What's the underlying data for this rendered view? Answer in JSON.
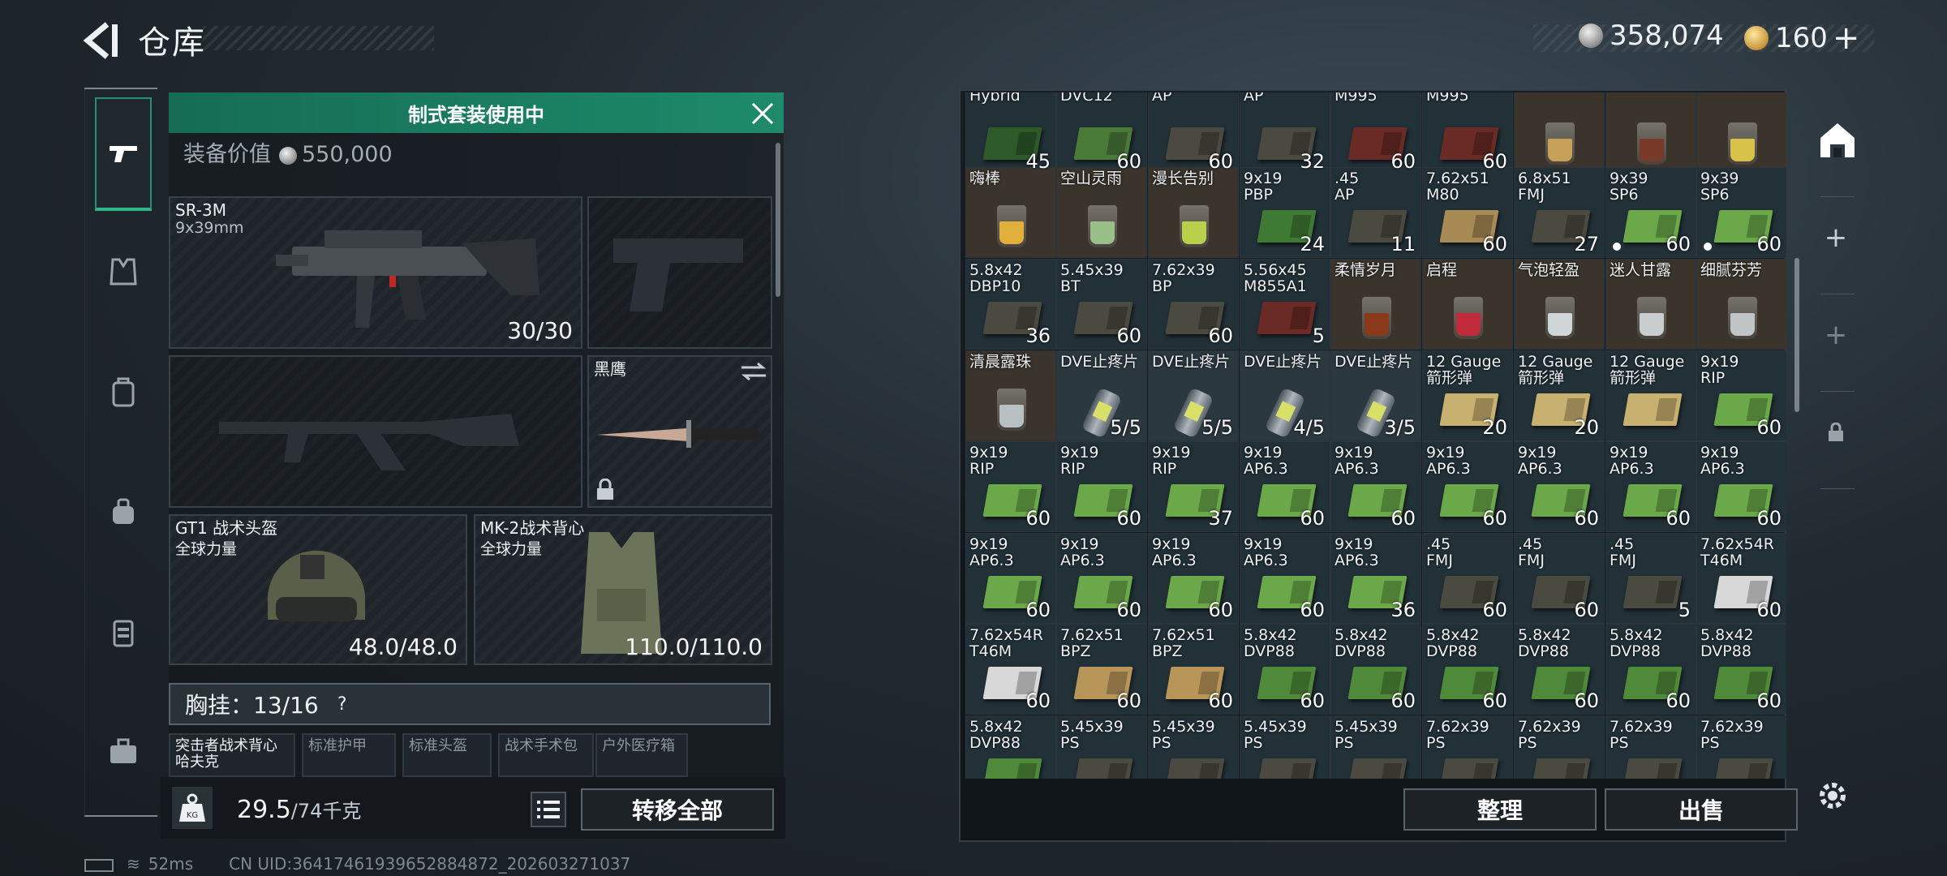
{
  "header": {
    "title": "仓库",
    "silver": "358,074",
    "gold": "160",
    "plus": "+"
  },
  "banner": {
    "text": "制式套装使用中"
  },
  "loadout": {
    "value_label": "装备价值",
    "value": "550,000",
    "primary": {
      "name": "SR-3M",
      "sub": "9x39mm",
      "ammo": "30/30"
    },
    "melee": {
      "name": "黑鹰"
    },
    "helmet": {
      "name": "GT1 战术头盔",
      "brand": "全球力量",
      "dur": "48.0/48.0"
    },
    "vest": {
      "name": "MK-2战术背心",
      "brand": "全球力量",
      "dur": "110.0/110.0"
    },
    "rig": {
      "label": "胸挂：13/16",
      "help": "?"
    },
    "rig_slots": [
      {
        "l1": "突击者战术背心",
        "l2": "哈夫克"
      },
      {
        "l1": "标准护甲",
        "l2": ""
      },
      {
        "l1": "标准头盔",
        "l2": ""
      },
      {
        "l1": "战术手术包",
        "l2": ""
      },
      {
        "l1": "户外医疗箱",
        "l2": ""
      }
    ],
    "weight": "29.5",
    "weight_max": "/74千克",
    "kg": "KG",
    "transfer": "转移全部"
  },
  "status": {
    "ping": "52ms",
    "uid": "CN UID:3641746193965288487​2_202603271037"
  },
  "grid_buttons": {
    "sort": "整理",
    "sell": "出售"
  },
  "grid": [
    [
      {
        "a": "Hybrid",
        "b": "",
        "c": "45",
        "k": "ammo",
        "col": "#2e5a2a"
      },
      {
        "a": "DVC12",
        "b": "",
        "c": "60",
        "k": "ammo",
        "col": "#4a7a38"
      },
      {
        "a": "AP",
        "b": "",
        "c": "60",
        "k": "ammo",
        "col": "#4a4a40"
      },
      {
        "a": "AP",
        "b": "",
        "c": "32",
        "k": "ammo",
        "col": "#4a4a40"
      },
      {
        "a": "M995",
        "b": "",
        "c": "60",
        "k": "ammo",
        "col": "#6a2a26"
      },
      {
        "a": "M995",
        "b": "",
        "c": "60",
        "k": "ammo",
        "col": "#6a2a26"
      },
      {
        "a": "",
        "b": "",
        "c": "",
        "k": "drink",
        "col": "#c7a05a"
      },
      {
        "a": "",
        "b": "",
        "c": "",
        "k": "drink",
        "col": "#7a3a2a"
      },
      {
        "a": "",
        "b": "",
        "c": "",
        "k": "drink",
        "col": "#d9c24a"
      }
    ],
    [
      {
        "a": "嗨棒",
        "b": "",
        "c": "",
        "k": "drink",
        "col": "#e0b03a"
      },
      {
        "a": "空山灵雨",
        "b": "",
        "c": "",
        "k": "drink",
        "col": "#9ac08a"
      },
      {
        "a": "漫长告别",
        "b": "",
        "c": "",
        "k": "drink",
        "col": "#b8d04a"
      },
      {
        "a": "9x19",
        "b": "PBP",
        "c": "24",
        "k": "ammo",
        "col": "#3f7a34"
      },
      {
        "a": ".45",
        "b": "AP",
        "c": "11",
        "k": "ammo",
        "col": "#4a4a40"
      },
      {
        "a": "7.62x51",
        "b": "M80",
        "c": "60",
        "k": "ammo",
        "col": "#a88a55"
      },
      {
        "a": "6.8x51",
        "b": "FMJ",
        "c": "27",
        "k": "ammo",
        "col": "#4a4a40"
      },
      {
        "a": "9x39",
        "b": "SP6",
        "c": "60",
        "k": "ammo",
        "col": "#6aa84a",
        "dot": true
      },
      {
        "a": "9x39",
        "b": "SP6",
        "c": "60",
        "k": "ammo",
        "col": "#6aa84a",
        "dot": true
      }
    ],
    [
      {
        "a": "5.8x42",
        "b": "DBP10",
        "c": "36",
        "k": "ammo",
        "col": "#4a4a40"
      },
      {
        "a": "5.45x39",
        "b": "BT",
        "c": "60",
        "k": "ammo",
        "col": "#4a4a40"
      },
      {
        "a": "7.62x39",
        "b": "BP",
        "c": "60",
        "k": "ammo",
        "col": "#4a4a40"
      },
      {
        "a": "5.56x45",
        "b": "M855A1",
        "c": "5",
        "k": "ammo",
        "col": "#6a2a26"
      },
      {
        "a": "柔情岁月",
        "b": "",
        "c": "",
        "k": "drink",
        "col": "#8a3a1a"
      },
      {
        "a": "启程",
        "b": "",
        "c": "",
        "k": "drink",
        "col": "#c02a3a"
      },
      {
        "a": "气泡轻盈",
        "b": "",
        "c": "",
        "k": "drink",
        "col": "#d0d6d8"
      },
      {
        "a": "迷人甘露",
        "b": "",
        "c": "",
        "k": "drink",
        "col": "#c8ced0"
      },
      {
        "a": "细腻芬芳",
        "b": "",
        "c": "",
        "k": "drink",
        "col": "#c0c6c8"
      }
    ],
    [
      {
        "a": "清晨露珠",
        "b": "",
        "c": "",
        "k": "drink",
        "col": "#b8c0c2"
      },
      {
        "a": "DVE止疼片",
        "b": "",
        "c": "5/5",
        "k": "inj"
      },
      {
        "a": "DVE止疼片",
        "b": "",
        "c": "5/5",
        "k": "inj"
      },
      {
        "a": "DVE止疼片",
        "b": "",
        "c": "4/5",
        "k": "inj"
      },
      {
        "a": "DVE止疼片",
        "b": "",
        "c": "3/5",
        "k": "inj"
      },
      {
        "a": "12 Gauge",
        "b": "箭形弹",
        "c": "20",
        "k": "ammo",
        "col": "#c8b070"
      },
      {
        "a": "12 Gauge",
        "b": "箭形弹",
        "c": "20",
        "k": "ammo",
        "col": "#c8b070"
      },
      {
        "a": "12 Gauge",
        "b": "箭形弹",
        "c": "",
        "k": "ammo",
        "col": "#c8b070"
      },
      {
        "a": "9x19",
        "b": "RIP",
        "c": "60",
        "k": "ammo",
        "col": "#6aa84a"
      }
    ],
    [
      {
        "a": "9x19",
        "b": "RIP",
        "c": "60",
        "k": "ammo",
        "col": "#6aa84a"
      },
      {
        "a": "9x19",
        "b": "RIP",
        "c": "60",
        "k": "ammo",
        "col": "#6aa84a"
      },
      {
        "a": "9x19",
        "b": "RIP",
        "c": "37",
        "k": "ammo",
        "col": "#6aa84a"
      },
      {
        "a": "9x19",
        "b": "AP6.3",
        "c": "60",
        "k": "ammo",
        "col": "#6aa84a"
      },
      {
        "a": "9x19",
        "b": "AP6.3",
        "c": "60",
        "k": "ammo",
        "col": "#6aa84a"
      },
      {
        "a": "9x19",
        "b": "AP6.3",
        "c": "60",
        "k": "ammo",
        "col": "#6aa84a"
      },
      {
        "a": "9x19",
        "b": "AP6.3",
        "c": "60",
        "k": "ammo",
        "col": "#6aa84a"
      },
      {
        "a": "9x19",
        "b": "AP6.3",
        "c": "60",
        "k": "ammo",
        "col": "#6aa84a"
      },
      {
        "a": "9x19",
        "b": "AP6.3",
        "c": "60",
        "k": "ammo",
        "col": "#6aa84a"
      }
    ],
    [
      {
        "a": "9x19",
        "b": "AP6.3",
        "c": "60",
        "k": "ammo",
        "col": "#6aa84a"
      },
      {
        "a": "9x19",
        "b": "AP6.3",
        "c": "60",
        "k": "ammo",
        "col": "#6aa84a"
      },
      {
        "a": "9x19",
        "b": "AP6.3",
        "c": "60",
        "k": "ammo",
        "col": "#6aa84a"
      },
      {
        "a": "9x19",
        "b": "AP6.3",
        "c": "60",
        "k": "ammo",
        "col": "#6aa84a"
      },
      {
        "a": "9x19",
        "b": "AP6.3",
        "c": "36",
        "k": "ammo",
        "col": "#6aa84a"
      },
      {
        "a": ".45",
        "b": "FMJ",
        "c": "60",
        "k": "ammo",
        "col": "#4a4a40"
      },
      {
        "a": ".45",
        "b": "FMJ",
        "c": "60",
        "k": "ammo",
        "col": "#4a4a40"
      },
      {
        "a": ".45",
        "b": "FMJ",
        "c": "5",
        "k": "ammo",
        "col": "#4a4a40"
      },
      {
        "a": "7.62x54R",
        "b": "T46M",
        "c": "60",
        "k": "ammo",
        "col": "#d8d8d8"
      }
    ],
    [
      {
        "a": "7.62x54R",
        "b": "T46M",
        "c": "60",
        "k": "ammo",
        "col": "#d8d8d8"
      },
      {
        "a": "7.62x51",
        "b": "BPZ",
        "c": "60",
        "k": "ammo",
        "col": "#b8965a"
      },
      {
        "a": "7.62x51",
        "b": "BPZ",
        "c": "60",
        "k": "ammo",
        "col": "#b8965a"
      },
      {
        "a": "5.8x42",
        "b": "DVP88",
        "c": "60",
        "k": "ammo",
        "col": "#4f8a3a"
      },
      {
        "a": "5.8x42",
        "b": "DVP88",
        "c": "60",
        "k": "ammo",
        "col": "#4f8a3a"
      },
      {
        "a": "5.8x42",
        "b": "DVP88",
        "c": "60",
        "k": "ammo",
        "col": "#4f8a3a"
      },
      {
        "a": "5.8x42",
        "b": "DVP88",
        "c": "60",
        "k": "ammo",
        "col": "#4f8a3a"
      },
      {
        "a": "5.8x42",
        "b": "DVP88",
        "c": "60",
        "k": "ammo",
        "col": "#4f8a3a"
      },
      {
        "a": "5.8x42",
        "b": "DVP88",
        "c": "60",
        "k": "ammo",
        "col": "#4f8a3a"
      }
    ],
    [
      {
        "a": "5.8x42",
        "b": "DVP88",
        "c": "",
        "k": "ammo",
        "col": "#4f8a3a"
      },
      {
        "a": "5.45x39",
        "b": "PS",
        "c": "",
        "k": "ammo",
        "col": "#4a4a40"
      },
      {
        "a": "5.45x39",
        "b": "PS",
        "c": "",
        "k": "ammo",
        "col": "#4a4a40"
      },
      {
        "a": "5.45x39",
        "b": "PS",
        "c": "",
        "k": "ammo",
        "col": "#4a4a40"
      },
      {
        "a": "5.45x39",
        "b": "PS",
        "c": "",
        "k": "ammo",
        "col": "#4a4a40"
      },
      {
        "a": "7.62x39",
        "b": "PS",
        "c": "",
        "k": "ammo",
        "col": "#4a4a40"
      },
      {
        "a": "7.62x39",
        "b": "PS",
        "c": "",
        "k": "ammo",
        "col": "#4a4a40"
      },
      {
        "a": "7.62x39",
        "b": "PS",
        "c": "",
        "k": "ammo",
        "col": "#4a4a40"
      },
      {
        "a": "7.62x39",
        "b": "PS",
        "c": "",
        "k": "ammo",
        "col": "#4a4a40"
      }
    ]
  ]
}
